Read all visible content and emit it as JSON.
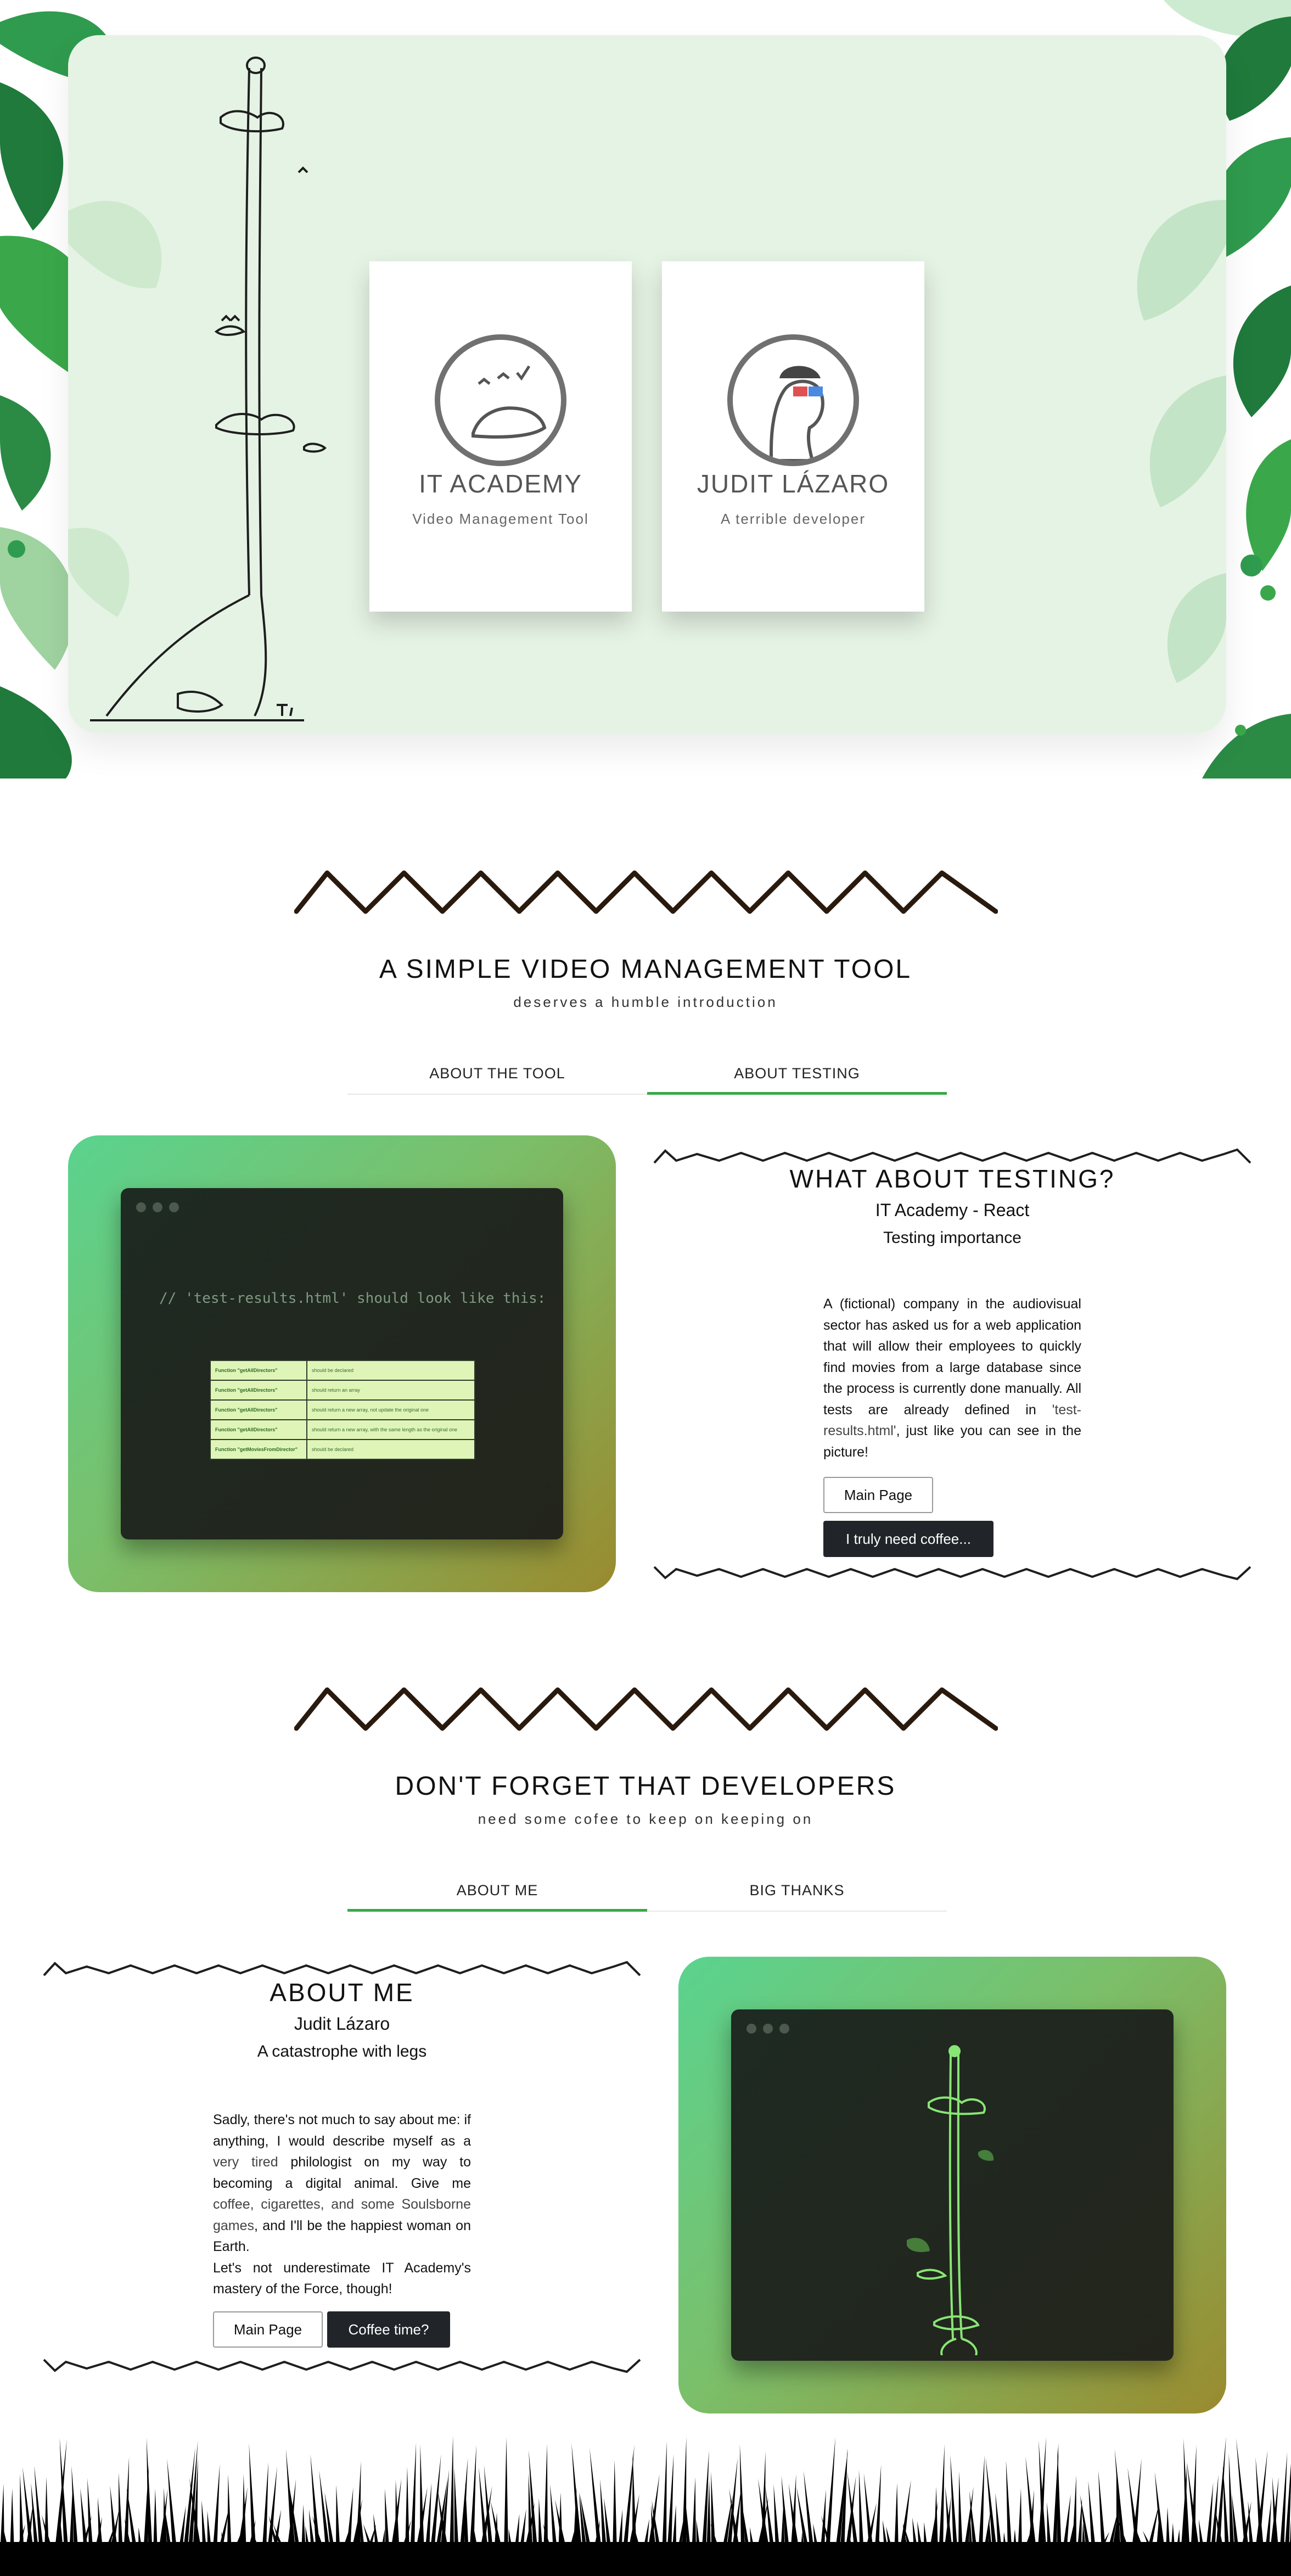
{
  "hero": {
    "cards": [
      {
        "title": "IT ACADEMY",
        "subtitle": "Video Management Tool",
        "logo": "giraffe-dinosaur-logo-icon"
      },
      {
        "title": "JUDIT LÁZARO",
        "subtitle": "A terrible developer",
        "logo": "dinosaur-with-3d-glasses-icon"
      }
    ]
  },
  "section1": {
    "title": "A SIMPLE VIDEO MANAGEMENT TOOL",
    "subtitle": "deserves a humble introduction",
    "tabs": [
      {
        "label": "ABOUT THE TOOL",
        "active": false
      },
      {
        "label": "ABOUT TESTING",
        "active": true
      }
    ],
    "terminal": {
      "code": "// 'test-results.html' should look like this:",
      "rows": [
        {
          "name": "Function \"getAllDirectors\"",
          "result": "should be declared"
        },
        {
          "name": "Function \"getAllDirectors\"",
          "result": "should return an array"
        },
        {
          "name": "Function \"getAllDirectors\"",
          "result": "should return a new array, not update the original one"
        },
        {
          "name": "Function \"getAllDirectors\"",
          "result": "should return a new array, with the same length as the original one"
        },
        {
          "name": "Function \"getMoviesFromDirector\"",
          "result": "should be declared"
        }
      ]
    },
    "panel": {
      "title": "WHAT ABOUT TESTING?",
      "heading": "IT Academy - React",
      "subheading": "Testing importance",
      "text_a": "A (fictional) company in the audiovisual sector has asked us for a web application that will allow their employees to quickly find movies from a large database since the process is currently done manually. All tests are already defined in ",
      "text_file": "'test-results.html'",
      "text_b": ", just like you can see in the picture!",
      "buttons": {
        "main": "Main Page",
        "coffee": "I truly need coffee..."
      }
    }
  },
  "section2": {
    "title": "DON'T FORGET THAT DEVELOPERS",
    "subtitle": "need some cofee to keep on keeping on",
    "tabs": [
      {
        "label": "ABOUT ME",
        "active": true
      },
      {
        "label": "BIG THANKS",
        "active": false
      }
    ],
    "panel": {
      "title": "ABOUT ME",
      "heading": "Judit Lázaro",
      "subheading": "A catastrophe with legs",
      "p1_a": "Sadly, there's not much to say about me: if anything, I would describe myself as a ",
      "p1_tired": "very tired",
      "p1_b": " philologist on my way to becoming a digital animal. Give me ",
      "p1_vices": "coffee, cigarettes, and some Soulsborne games",
      "p1_c": ", and I'll be the happiest woman on Earth.",
      "p2": "Let's not underestimate IT Academy's mastery of the Force, though!",
      "buttons": {
        "main": "Main Page",
        "coffee": "Coffee time?"
      }
    }
  },
  "colors": {
    "accent_green": "#3aa84a",
    "hero_panel": "#e5f3e4",
    "dark_button": "#212529",
    "test_row": "#dff5b8"
  }
}
